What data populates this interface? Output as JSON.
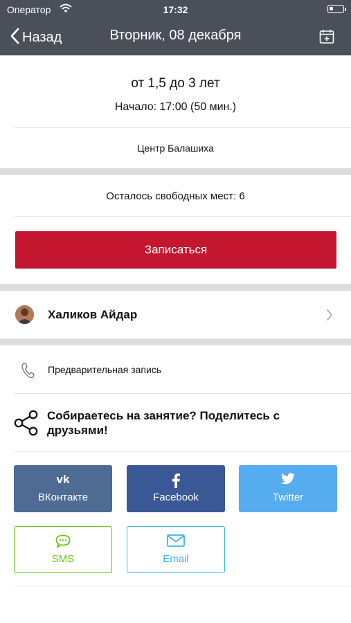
{
  "status_bar": {
    "carrier": "Оператор",
    "time": "17:32"
  },
  "nav": {
    "back_label": "Назад",
    "title": "Вторник, 08 декабря"
  },
  "class_info": {
    "age_group": "от 1,5 до 3 лет",
    "start": "Начало: 17:00 (50 мин.)",
    "location": "Центр Балашиха"
  },
  "booking": {
    "free_spots": "Осталось свободных мест: 6",
    "signup_label": "Записаться"
  },
  "teacher": {
    "name": "Халиков Айдар"
  },
  "contact": {
    "phone_label": "Предварительная запись"
  },
  "share": {
    "prompt": "Собираетесь на занятие? Поделитесь с друзьями!",
    "buttons": {
      "vk": "ВКонтакте",
      "facebook": "Facebook",
      "twitter": "Twitter",
      "sms": "SMS",
      "email": "Email"
    }
  },
  "colors": {
    "nav_background": "#4a4f5a",
    "primary_button": "#c5162f",
    "vk": "#4d6b93",
    "facebook": "#3a5896",
    "twitter": "#55acee",
    "sms": "#66c41a",
    "email": "#35b6e6"
  },
  "icons": {
    "wifi": "wifi-icon",
    "battery": "battery-icon",
    "back": "chevron-left-icon",
    "calendar": "calendar-add-icon",
    "chevron": "chevron-right-icon",
    "phone": "phone-icon",
    "share": "share-icon",
    "vk": "vk-icon",
    "facebook": "facebook-icon",
    "twitter": "twitter-icon",
    "sms": "sms-bubble-icon",
    "email": "envelope-icon"
  }
}
